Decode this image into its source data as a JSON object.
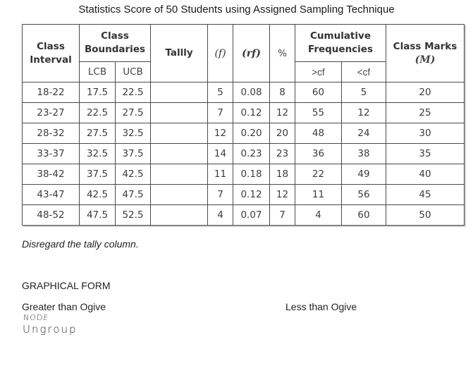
{
  "title": "Statistics Score of 50 Students using Assigned Sampling Technique",
  "table": {
    "headers": {
      "class_interval": "Class Interval",
      "class_boundaries": "Class Boundaries",
      "lcb": "LCB",
      "ucb": "UCB",
      "tally": "Tallly",
      "f": "(f)",
      "rf": "(rf)",
      "percent": "%",
      "cumulative": "Cumulative Frequencies",
      "gt_cf": ">cf",
      "lt_cf": "<cf",
      "class_marks": "Class Marks",
      "class_marks_symbol": "(M)"
    },
    "rows": [
      {
        "interval": "18-22",
        "lcb": "17.5",
        "ucb": "22.5",
        "tally": "",
        "f": "5",
        "rf": "0.08",
        "pct": "8",
        "gcf": "60",
        "lcf": "5",
        "m": "20"
      },
      {
        "interval": "23-27",
        "lcb": "22.5",
        "ucb": "27.5",
        "tally": "",
        "f": "7",
        "rf": "0.12",
        "pct": "12",
        "gcf": "55",
        "lcf": "12",
        "m": "25"
      },
      {
        "interval": "28-32",
        "lcb": "27.5",
        "ucb": "32.5",
        "tally": "",
        "f": "12",
        "rf": "0.20",
        "pct": "20",
        "gcf": "48",
        "lcf": "24",
        "m": "30"
      },
      {
        "interval": "33-37",
        "lcb": "32.5",
        "ucb": "37.5",
        "tally": "",
        "f": "14",
        "rf": "0.23",
        "pct": "23",
        "gcf": "36",
        "lcf": "38",
        "m": "35"
      },
      {
        "interval": "38-42",
        "lcb": "37.5",
        "ucb": "42.5",
        "tally": "",
        "f": "11",
        "rf": "0.18",
        "pct": "18",
        "gcf": "22",
        "lcf": "49",
        "m": "40"
      },
      {
        "interval": "43-47",
        "lcb": "42.5",
        "ucb": "47.5",
        "tally": "",
        "f": "7",
        "rf": "0.12",
        "pct": "12",
        "gcf": "11",
        "lcf": "56",
        "m": "45"
      },
      {
        "interval": "48-52",
        "lcb": "47.5",
        "ucb": "52.5",
        "tally": "",
        "f": "4",
        "rf": "0.07",
        "pct": "7",
        "gcf": "4",
        "lcf": "60",
        "m": "50"
      }
    ]
  },
  "note": "Disregard the tally column.",
  "section_heading": "GRAPHICAL FORM",
  "greater_than_ogive": "Greater than Ogive",
  "less_than_ogive": "Less than Ogive",
  "handwritten": {
    "line1": "NODE",
    "line2": "Ungroup"
  }
}
